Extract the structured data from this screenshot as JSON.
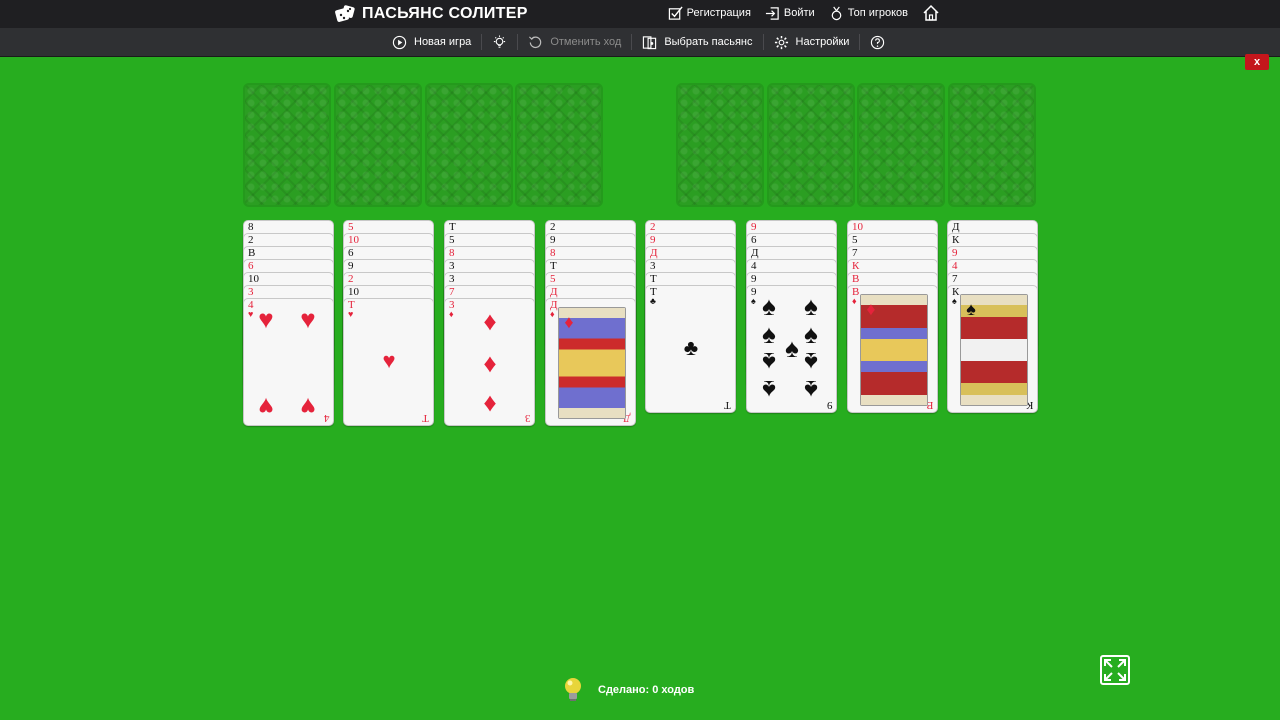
{
  "header": {
    "title": "ПАСЬЯНС СОЛИТЕР",
    "nav": [
      {
        "label": "Регистрация",
        "icon": "checkbox-edit-icon"
      },
      {
        "label": "Войти",
        "icon": "login-icon"
      },
      {
        "label": "Топ игроков",
        "icon": "medal-icon"
      },
      {
        "label": "",
        "icon": "home-icon"
      }
    ]
  },
  "toolbar": {
    "new_game": "Новая игра",
    "hint_icon": "bulb-icon",
    "undo": "Отменить ход",
    "choose": "Выбрать пасьянс",
    "settings": "Настройки",
    "help_icon": "question-icon"
  },
  "close_label": "x",
  "status": {
    "moves_text": "Сделано: 0 ходов"
  },
  "tableau": [
    {
      "stack": [
        [
          "8",
          "black"
        ],
        [
          "2",
          "black"
        ],
        [
          "В",
          "black"
        ],
        [
          "6",
          "red"
        ],
        [
          "10",
          "black"
        ],
        [
          "3",
          "red"
        ]
      ],
      "top": {
        "rank": "4",
        "suit": "♥",
        "color": "red",
        "kind": "pips4"
      }
    },
    {
      "stack": [
        [
          "5",
          "red"
        ],
        [
          "10",
          "red"
        ],
        [
          "6",
          "black"
        ],
        [
          "9",
          "black"
        ],
        [
          "2",
          "red"
        ],
        [
          "10",
          "black"
        ]
      ],
      "top": {
        "rank": "Т",
        "suit": "♥",
        "color": "red",
        "kind": "ace"
      }
    },
    {
      "stack": [
        [
          "Т",
          "black"
        ],
        [
          "5",
          "black"
        ],
        [
          "8",
          "red"
        ],
        [
          "3",
          "black"
        ],
        [
          "3",
          "black"
        ],
        [
          "7",
          "red"
        ]
      ],
      "top": {
        "rank": "3",
        "suit": "♦",
        "color": "red",
        "kind": "pips3"
      }
    },
    {
      "stack": [
        [
          "2",
          "black"
        ],
        [
          "9",
          "black"
        ],
        [
          "8",
          "red"
        ],
        [
          "Т",
          "black"
        ],
        [
          "5",
          "red"
        ],
        [
          "Д",
          "red"
        ]
      ],
      "top": {
        "rank": "Д",
        "suit": "♦",
        "color": "red",
        "kind": "queen"
      }
    },
    {
      "stack": [
        [
          "2",
          "red"
        ],
        [
          "9",
          "red"
        ],
        [
          "Д",
          "red"
        ],
        [
          "3",
          "black"
        ],
        [
          "Т",
          "black"
        ]
      ],
      "top": {
        "rank": "Т",
        "suit": "♣",
        "color": "black",
        "kind": "ace"
      }
    },
    {
      "stack": [
        [
          "9",
          "red"
        ],
        [
          "6",
          "black"
        ],
        [
          "Д",
          "black"
        ],
        [
          "4",
          "black"
        ],
        [
          "9",
          "black"
        ]
      ],
      "top": {
        "rank": "9",
        "suit": "♠",
        "color": "black",
        "kind": "pips9"
      }
    },
    {
      "stack": [
        [
          "10",
          "red"
        ],
        [
          "5",
          "black"
        ],
        [
          "7",
          "black"
        ],
        [
          "К",
          "red"
        ],
        [
          "В",
          "red"
        ]
      ],
      "top": {
        "rank": "В",
        "suit": "♦",
        "color": "red",
        "kind": "jack"
      }
    },
    {
      "stack": [
        [
          "Д",
          "black"
        ],
        [
          "К",
          "black"
        ],
        [
          "9",
          "red"
        ],
        [
          "4",
          "red"
        ],
        [
          "7",
          "black"
        ]
      ],
      "top": {
        "rank": "К",
        "suit": "♠",
        "color": "black",
        "kind": "king"
      }
    }
  ]
}
